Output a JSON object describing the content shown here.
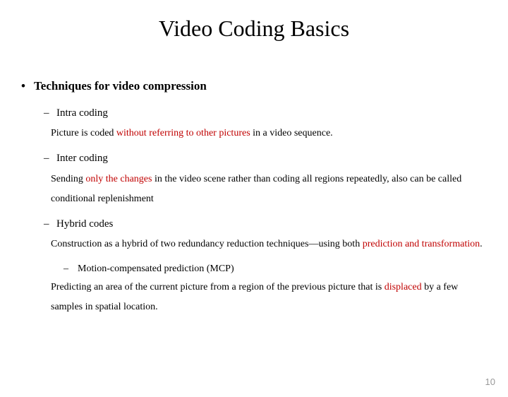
{
  "title": "Video Coding Basics",
  "heading": "Techniques for video compression",
  "items": {
    "intra": {
      "label": "Intra coding",
      "d1": "Picture is coded ",
      "d2": "without referring to other pictures",
      "d3": " in a video sequence."
    },
    "inter": {
      "label": "Inter coding",
      "d1": "Sending ",
      "d2": "only the changes",
      "d3": " in the video scene rather than coding all regions repeatedly, also can be called conditional replenishment"
    },
    "hybrid": {
      "label": "Hybrid codes",
      "d1": "Construction as a hybrid of two redundancy reduction techniques—using both ",
      "d2": "prediction and transformation",
      "d3": "."
    },
    "mcp": {
      "label": "Motion-compensated prediction (MCP)",
      "d1": "Predicting an area of the current picture from a region of the previous picture that is ",
      "d2": "displaced",
      "d3": " by a few samples in spatial location."
    }
  },
  "page_number": "10"
}
